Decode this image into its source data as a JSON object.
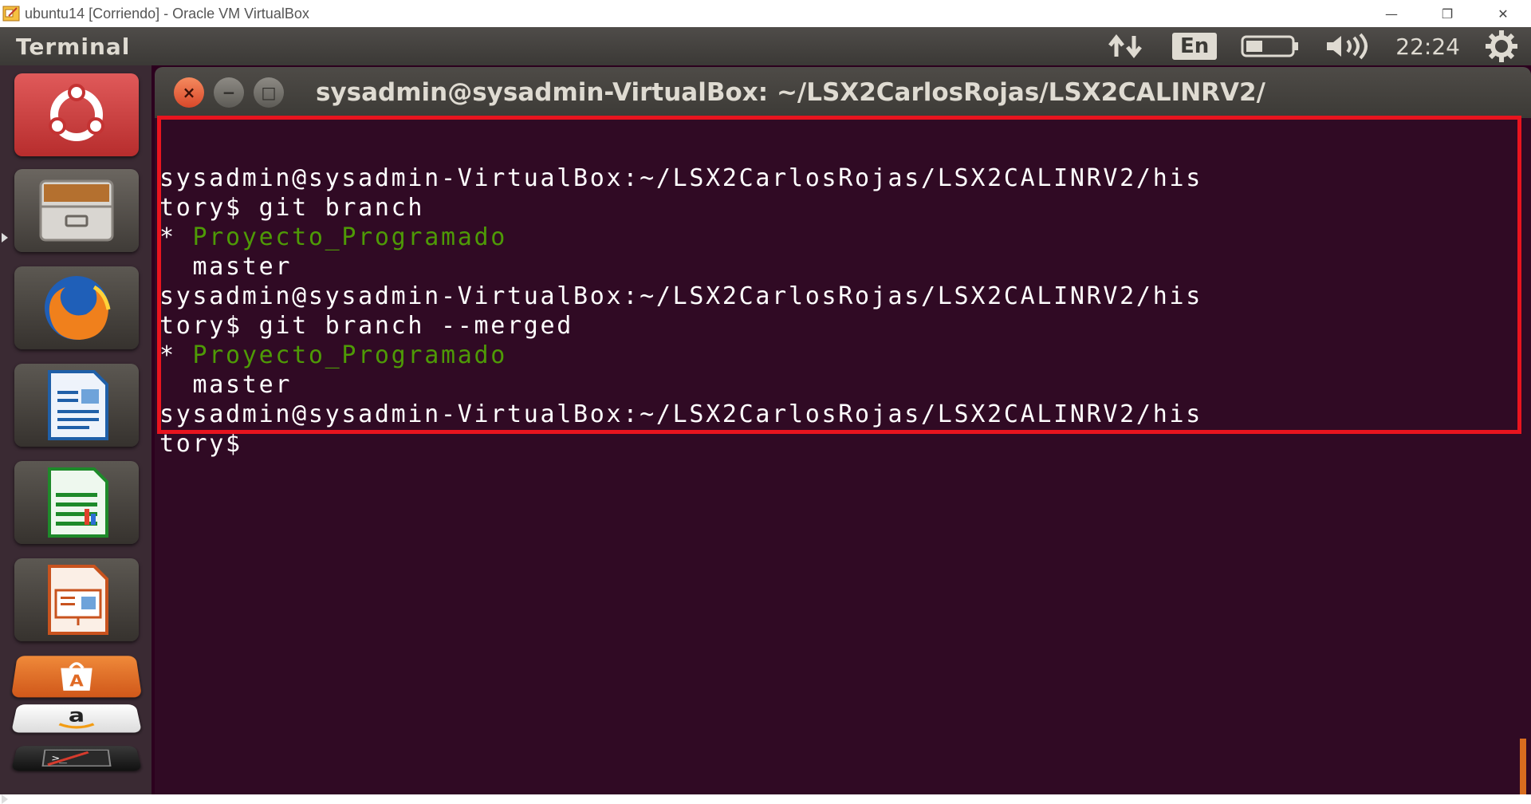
{
  "host": {
    "title": "ubuntu14 [Corriendo] - Oracle VM VirtualBox",
    "controls": {
      "minimize": "—",
      "restore": "❐",
      "close": "✕"
    }
  },
  "panel": {
    "app_name": "Terminal",
    "lang": "En",
    "clock": "22:24",
    "icons": [
      "network-icon",
      "keyboard-lang-icon",
      "battery-icon",
      "volume-icon",
      "settings-gear-icon"
    ]
  },
  "launcher": {
    "items": [
      "dash-home",
      "files",
      "firefox",
      "writer",
      "calc",
      "impress",
      "software-center",
      "amazon",
      "terminal"
    ]
  },
  "window": {
    "title": "sysadmin@sysadmin-VirtualBox: ~/LSX2CarlosRojas/LSX2CALINRV2/",
    "buttons": {
      "close": "×",
      "minimize": "−",
      "maximize": "□"
    }
  },
  "terminal": {
    "lines": [
      {
        "text": "sysadmin@sysadmin-VirtualBox:~/LSX2CarlosRojas/LSX2CALINRV2/his"
      },
      {
        "text": "tory$ git branch"
      },
      {
        "prefix": "* ",
        "green": "Proyecto_Programado"
      },
      {
        "text": "  master"
      },
      {
        "text": "sysadmin@sysadmin-VirtualBox:~/LSX2CarlosRojas/LSX2CALINRV2/his"
      },
      {
        "text": "tory$ git branch --merged"
      },
      {
        "prefix": "* ",
        "green": "Proyecto_Programado"
      },
      {
        "text": "  master"
      },
      {
        "text": "sysadmin@sysadmin-VirtualBox:~/LSX2CarlosRojas/LSX2CALINRV2/his"
      },
      {
        "text": "tory$"
      }
    ]
  },
  "colors": {
    "terminal_bg": "#300a24",
    "branch_green": "#4e9a06",
    "highlight_red": "#e8141e"
  }
}
